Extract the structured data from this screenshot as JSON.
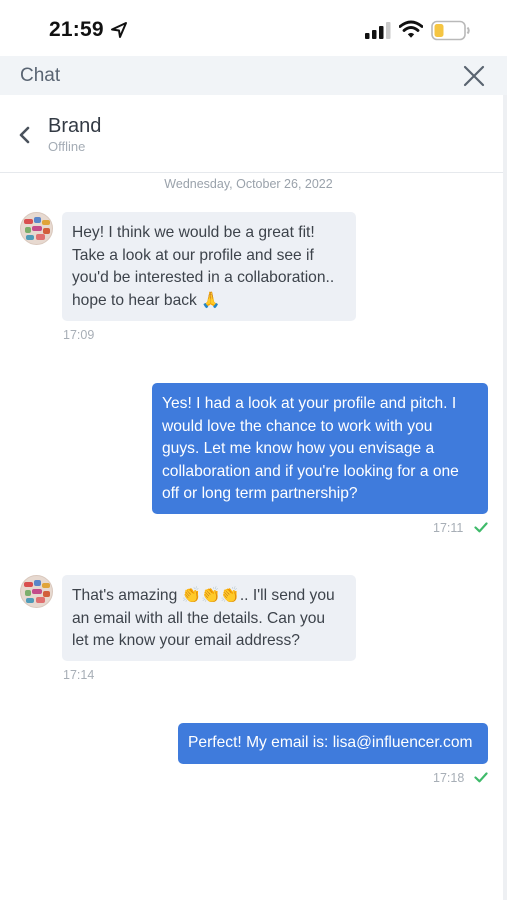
{
  "status_bar": {
    "time": "21:59",
    "icons": [
      "location-arrow-icon",
      "cellular-signal-icon",
      "wifi-icon",
      "battery-low-icon"
    ],
    "battery_color": "#f5c542"
  },
  "header": {
    "title": "Chat",
    "close_icon": "close-icon"
  },
  "contact": {
    "name": "Brand",
    "status": "Offline",
    "back_icon": "chevron-left-icon"
  },
  "conversation": {
    "date": "Wednesday, October 26, 2022",
    "messages": [
      {
        "direction": "incoming",
        "lines": [
          "Hey! I think we would be a great fit!",
          "Take a look at our profile and see if",
          "you'd be interested in a collaboration..",
          "hope to hear back 🙏"
        ],
        "time": "17:09"
      },
      {
        "direction": "outgoing",
        "lines": [
          "Yes! I had a look at your profile and pitch. I",
          "would love the chance to work with you",
          "guys. Let me know how you envisage a",
          "collaboration and if you're looking for a one",
          "off or long term partnership?"
        ],
        "time": "17:11",
        "read": true
      },
      {
        "direction": "incoming",
        "lines": [
          "That's amazing 👏👏👏.. I'll send you",
          "an email with all the details. Can you",
          "let me know your email address?"
        ],
        "time": "17:14"
      },
      {
        "direction": "outgoing",
        "lines": [
          "Perfect! My email is: lisa@influencer.com"
        ],
        "time": "17:18",
        "read": true
      }
    ]
  },
  "colors": {
    "outgoing_bubble": "#3f7bdc",
    "incoming_bubble": "#edf0f5",
    "read_check": "#3fba6a",
    "title_bar": "#f1f4f7"
  }
}
